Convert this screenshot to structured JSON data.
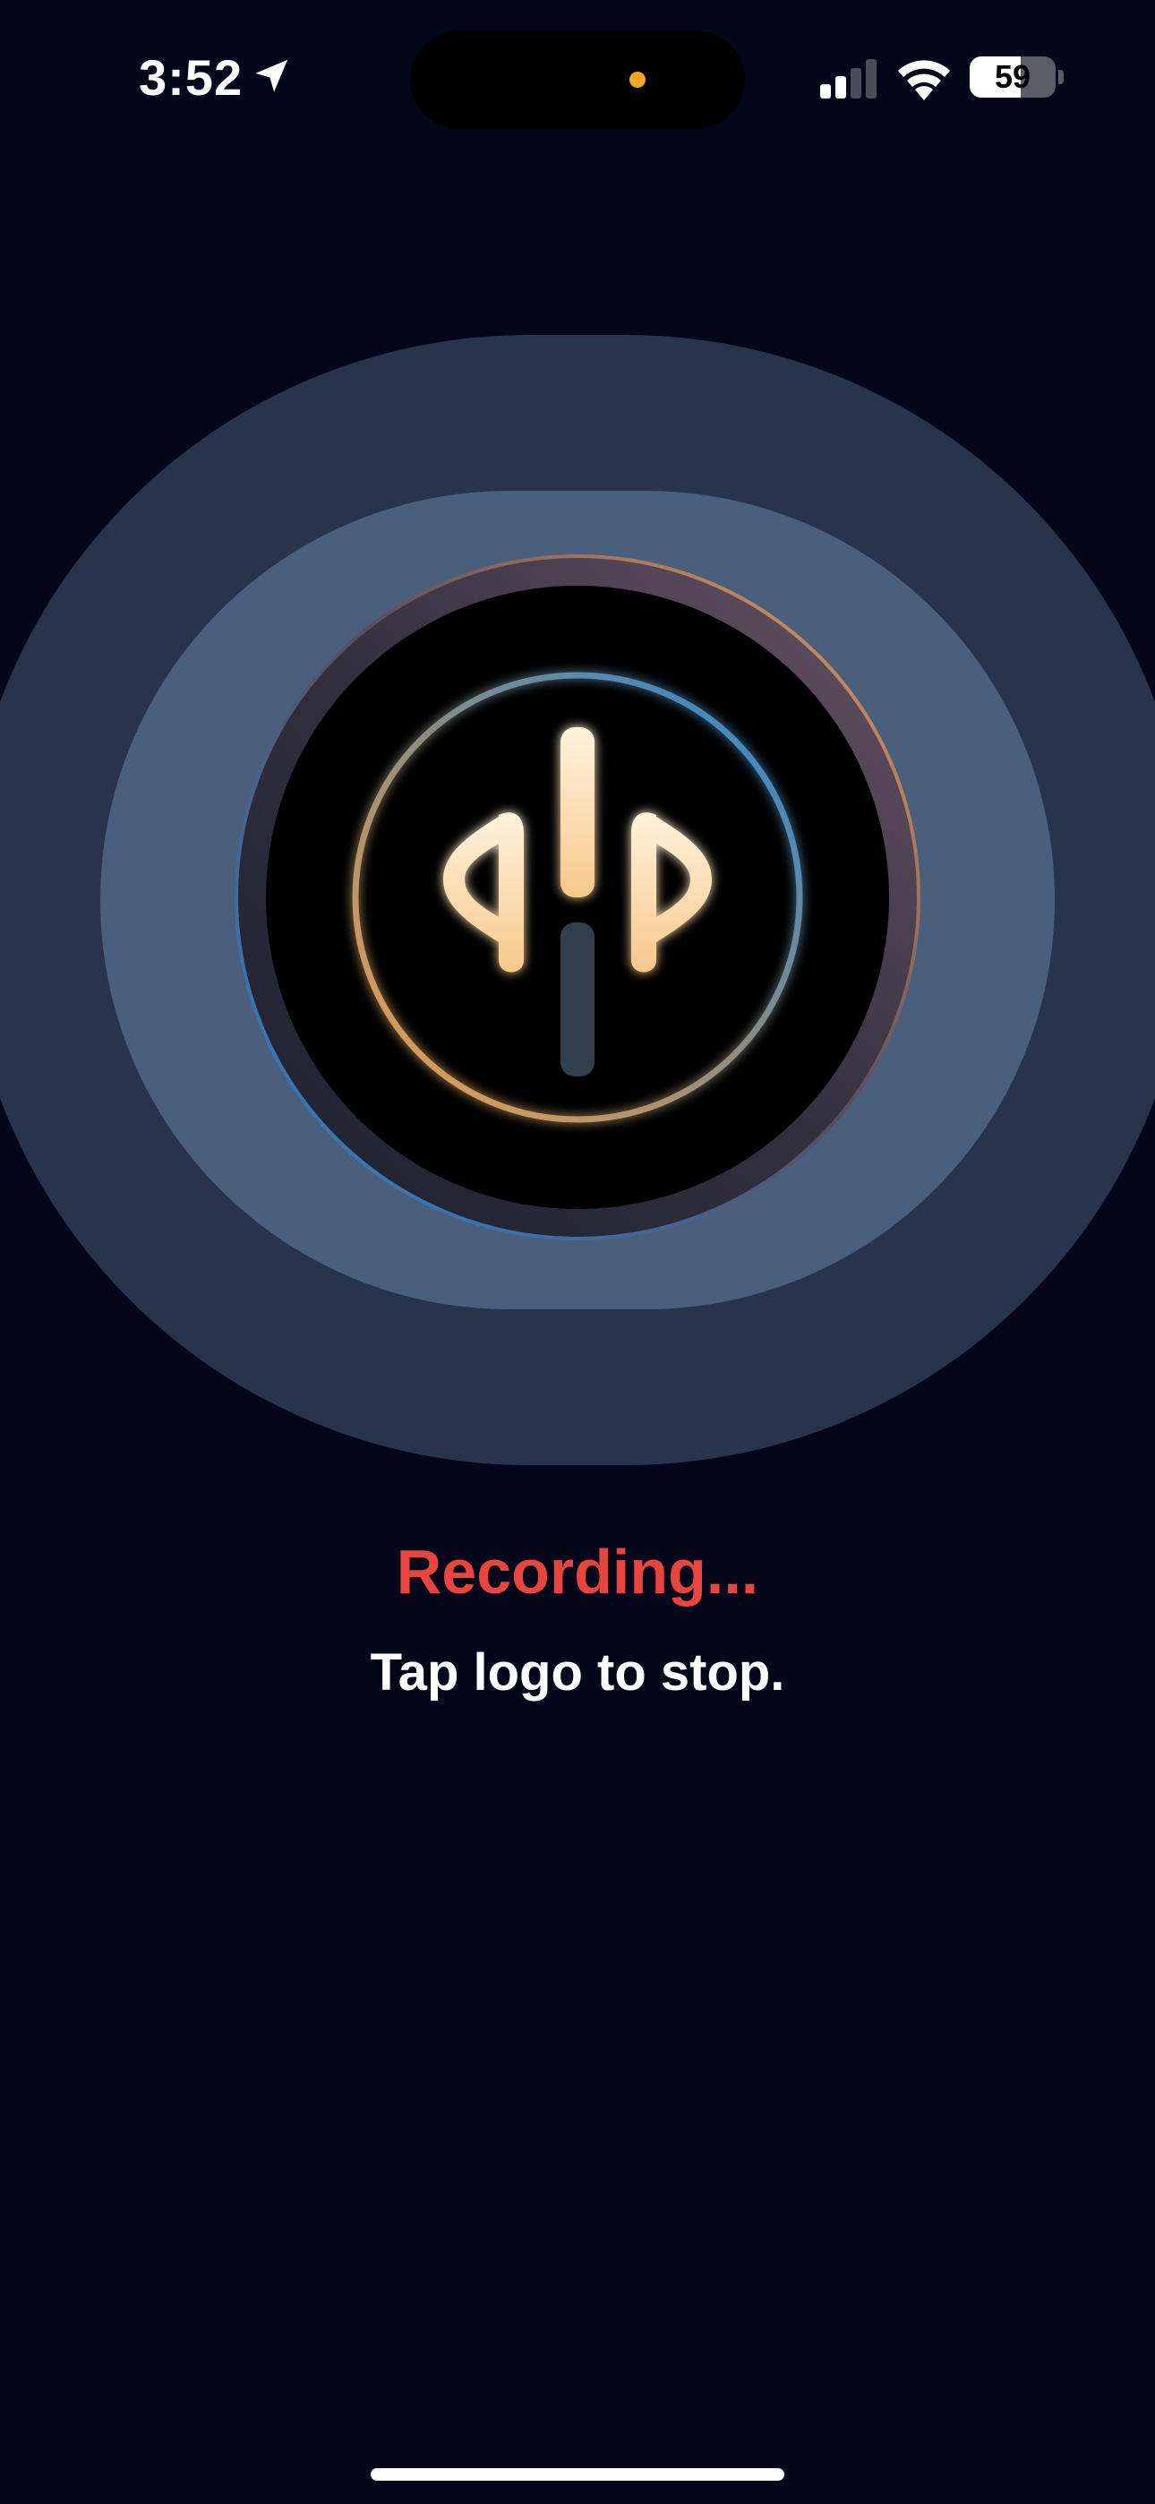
{
  "status_bar": {
    "time": "3:52",
    "battery_level": "59",
    "battery_fraction": 0.59,
    "signal_bars": 2,
    "signal_bars_total": 4,
    "icons": [
      "location-arrow-icon",
      "signal-icon",
      "wifi-icon",
      "battery-icon"
    ],
    "island_indicator_color": "#f5a623"
  },
  "recording": {
    "title": "Recording...",
    "hint": "Tap logo to stop."
  },
  "colors": {
    "background": "#04071a",
    "halo_outer": "#28344b",
    "halo_inner": "#4a5f7b",
    "recording_red": "#e8453f",
    "logo_glow_orange": "#f3a559",
    "ring_blue": "#2a86d4"
  }
}
